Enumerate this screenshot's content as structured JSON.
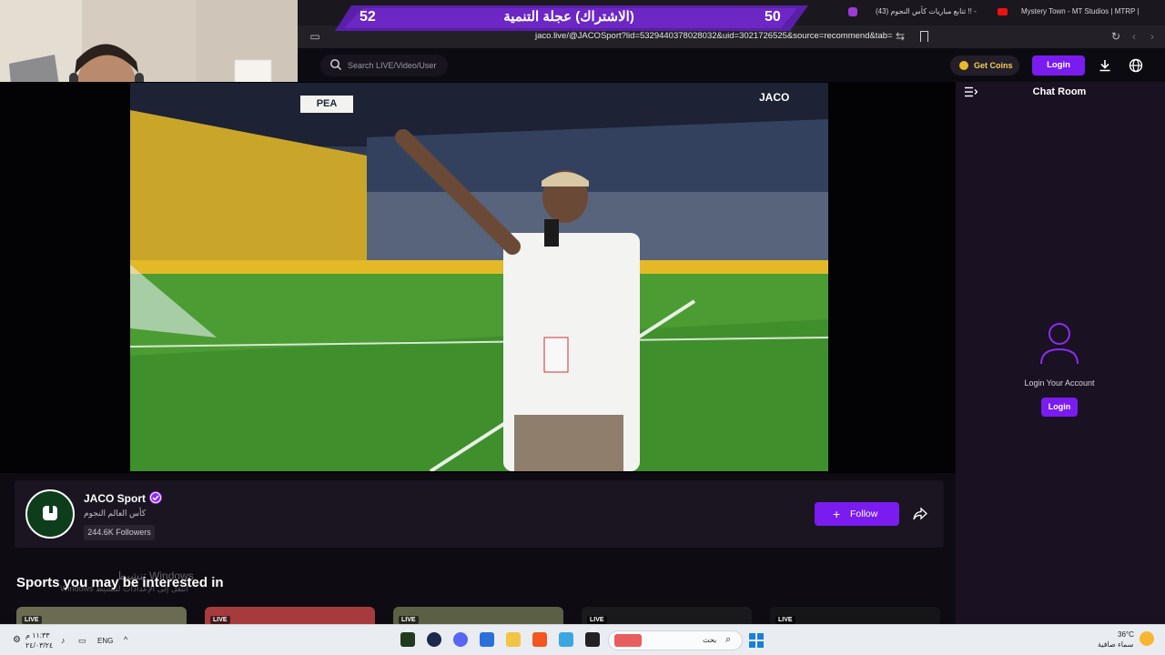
{
  "browser": {
    "tabs": [
      "Mystery Town - MT Studios | MTRP |",
      "(43) تتابع مباريات كأس النجوم !! -"
    ],
    "url": "jaco.live/@JACOSport?lid=5329440378028032&uid=3021726525&source=recommend&tab="
  },
  "banner": {
    "left_number": "52",
    "title": "(الاشتراك) عجلة التنمية",
    "right_number": "50",
    "color": "#5a1fa8"
  },
  "header": {
    "search_placeholder": "Search LIVE/Video/User",
    "coins_label": "Get Coins",
    "login_label": "Login",
    "accent": "#7a1cf0"
  },
  "video": {
    "badge": "PEA",
    "watermark": "JACO"
  },
  "chat": {
    "title": "Chat Room",
    "login_prompt": "Login Your Account",
    "login_label": "Login"
  },
  "channel": {
    "name": "JACO Sport",
    "subtitle": "كأس العالم النجوم",
    "followers": "244.6K Followers",
    "follow_label": "Follow"
  },
  "recommend": {
    "title": "Sports you may be interested in",
    "live_badge": "LIVE",
    "watermark_line1": "تنشيط Windows",
    "watermark_line2": "انتقل إلى الإعدادات لتنشيط Windows"
  },
  "taskbar": {
    "time": "١١:٣٣ م",
    "date": "٢٤/٠٣/٢٤",
    "lang": "ENG",
    "search_placeholder": "بحث",
    "temperature": "36°C",
    "weather": "سماء صافية"
  }
}
